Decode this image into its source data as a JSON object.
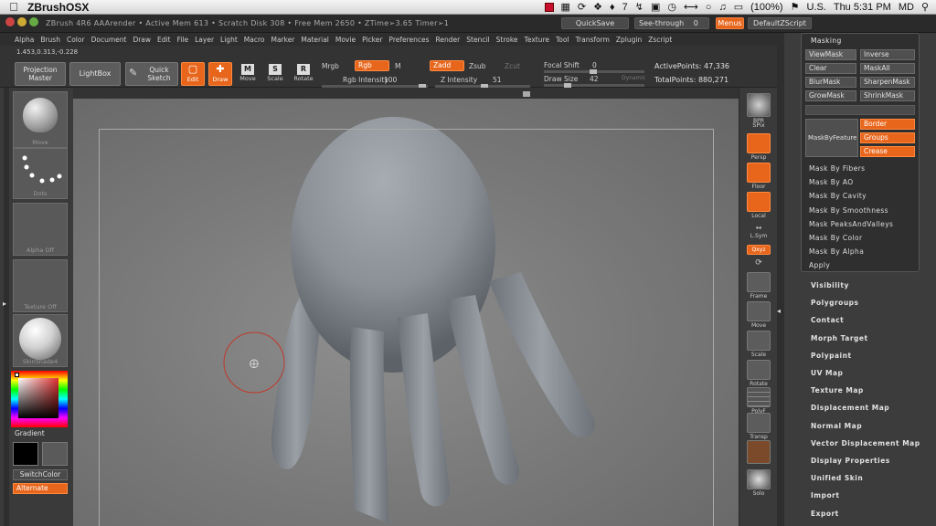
{
  "macbar": {
    "app_name": "ZBrushOSX",
    "battery": "(100%)",
    "input_lang": "U.S.",
    "badge_count": "7",
    "clock": "Thu 5:31 PM",
    "user": "MD"
  },
  "titlebar": {
    "text": "ZBrush 4R6     AAArender  • Active Mem 613 • Scratch Disk 308 • Free Mem 2650 • ZTime➢3.65 Timer➢1",
    "quicksave": "QuickSave",
    "seethrough": "See-through",
    "seethrough_value": "0",
    "menus": "Menus",
    "default_zscript": "DefaultZScript"
  },
  "menus": [
    "Alpha",
    "Brush",
    "Color",
    "Document",
    "Draw",
    "Edit",
    "File",
    "Layer",
    "Light",
    "Macro",
    "Marker",
    "Material",
    "Movie",
    "Picker",
    "Preferences",
    "Render",
    "Stencil",
    "Stroke",
    "Texture",
    "Tool",
    "Transform",
    "Zplugin",
    "Zscript"
  ],
  "toolbar": {
    "coords": "1.453,0.313,-0.228",
    "projection_master": "Projection Master",
    "lightbox": "LightBox",
    "quick_sketch": "Quick Sketch",
    "edit": "Edit",
    "draw": "Draw",
    "move": "Move",
    "scale": "Scale",
    "rotate": "Rotate",
    "mrgb": "Mrgb",
    "rgb": "Rgb",
    "m": "M",
    "zadd": "Zadd",
    "zsub": "Zsub",
    "zcut": "Zcut",
    "rgb_intensity_label": "Rgb Intensity",
    "rgb_intensity_value": "100",
    "z_intensity_label": "Z Intensity",
    "z_intensity_value": "51",
    "focal_shift_label": "Focal Shift",
    "focal_shift_value": "0",
    "draw_size_label": "Draw Size",
    "draw_size_value": "42",
    "dynamic": "Dynamic",
    "active_points": "ActivePoints: 47,336",
    "total_points": "TotalPoints: 880,271"
  },
  "leftshelf": {
    "brush_label": "Move",
    "stroke_label": "Dots",
    "alpha_label": "Alpha Off",
    "texture_label": "Texture Off",
    "material_label": "SkinShade4",
    "gradient": "Gradient",
    "switchcolor": "SwitchColor",
    "alternate": "Alternate"
  },
  "rightshelf": {
    "bpr": "BPR",
    "spix": "SPix",
    "persp": "Persp",
    "floor": "Floor",
    "local": "Local",
    "lsym": "L.Sym",
    "xyz": "Qxyz",
    "frame": "Frame",
    "move": "Move",
    "scale": "Scale",
    "rotate": "Rotate",
    "polyf": "PolyF",
    "transp": "Transp",
    "solo": "Solo"
  },
  "masking": {
    "title": "Masking",
    "viewmask": "ViewMask",
    "inverse": "Inverse",
    "clear": "Clear",
    "maskall": "MaskAll",
    "blurmask": "BlurMask",
    "sharpenmask": "SharpenMask",
    "growmask": "GrowMask",
    "shrinkmask": "ShrinkMask",
    "maskbyfeature": "MaskByFeature",
    "border": "Border",
    "groups": "Groups",
    "crease": "Crease",
    "items": [
      "Mask By Fibers",
      "Mask By AO",
      "Mask By Cavity",
      "Mask By Smoothness",
      "Mask PeaksAndValleys",
      "Mask By Color",
      "Mask By Alpha",
      "Apply"
    ]
  },
  "subpalettes": [
    "Visibility",
    "Polygroups",
    "Contact",
    "Morph Target",
    "Polypaint",
    "UV Map",
    "Texture Map",
    "Displacement Map",
    "Normal Map",
    "Vector Displacement Map",
    "Display Properties",
    "Unified Skin",
    "Import",
    "Export"
  ],
  "colors": {
    "accent": "#e8661c",
    "panel": "#3a3a3a",
    "canvas": "#7b7b7b",
    "model": "#8a9096"
  }
}
